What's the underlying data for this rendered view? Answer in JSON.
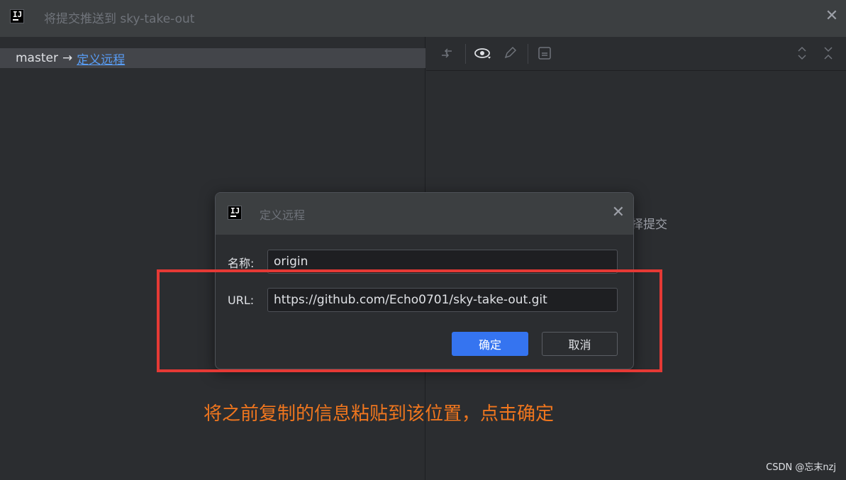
{
  "window": {
    "title": "将提交推送到 sky-take-out",
    "logo_text": "IJ",
    "close_glyph": "✕"
  },
  "left_pane": {
    "branch": "master",
    "arrow": "→",
    "remote_link": "定义远程"
  },
  "right_pane": {
    "toolbar_icons": [
      "diff-icon",
      "eye-icon",
      "edit-icon",
      "panel-icon",
      "expand-icon",
      "collapse-icon"
    ],
    "empty_text": "择提交"
  },
  "dialog": {
    "title": "定义远程",
    "logo_text": "IJ",
    "close_glyph": "✕",
    "name_label": "名称:",
    "name_value": "origin",
    "url_label": "URL:",
    "url_value": "https://github.com/Echo0701/sky-take-out.git",
    "ok_label": "确定",
    "cancel_label": "取消"
  },
  "annotation": {
    "text": "将之前复制的信息粘贴到该位置，点击确定",
    "color": "#f0761e",
    "box_color": "#e53935"
  },
  "watermark": "CSDN @忘末nzj",
  "colors": {
    "accent": "#3574f0",
    "link": "#589df6",
    "background": "#2b2d30"
  }
}
